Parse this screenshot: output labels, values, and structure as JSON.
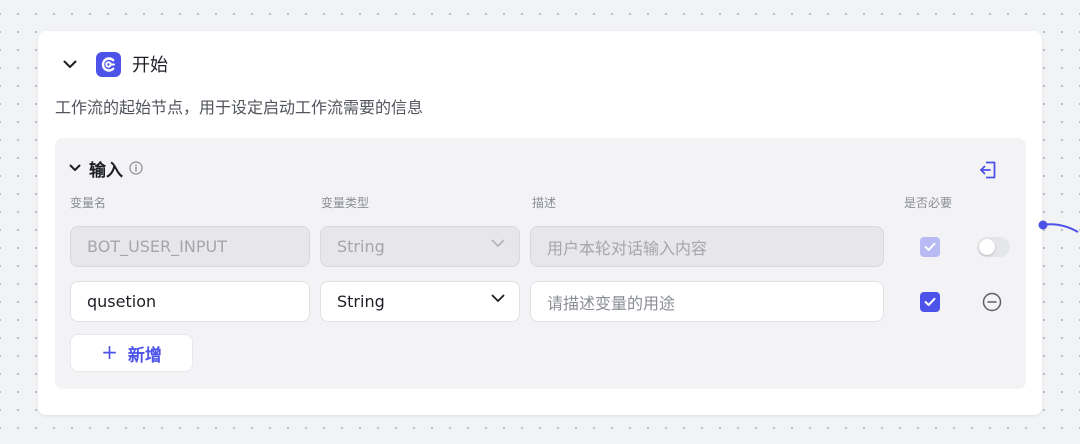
{
  "node": {
    "title": "开始",
    "description": "工作流的起始节点，用于设定启动工作流需要的信息",
    "accent_color": "#4d53e8"
  },
  "input": {
    "title": "输入",
    "columns": {
      "name": "变量名",
      "type": "变量类型",
      "desc": "描述",
      "required": "是否必要"
    },
    "rows": [
      {
        "name": "BOT_USER_INPUT",
        "type": "String",
        "description": "用户本轮对话输入内容",
        "required": true,
        "disabled": true
      },
      {
        "name": "qusetion",
        "type": "String",
        "description_placeholder": "请描述变量的用途",
        "required": true,
        "disabled": false
      }
    ],
    "add_label": "新增"
  },
  "icons": {
    "collapse": "chevron-down-icon",
    "node": "start-node-icon",
    "info": "info-icon",
    "exit": "exit-arrow-icon",
    "remove": "minus-circle-icon"
  }
}
